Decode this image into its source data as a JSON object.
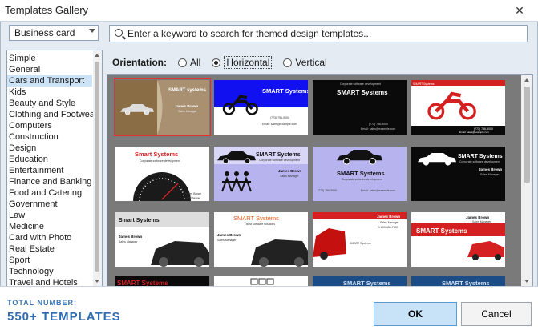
{
  "window": {
    "title": "Templates Gallery",
    "close_glyph": "✕"
  },
  "category_select": {
    "value": "Business card"
  },
  "search": {
    "placeholder": "Enter a keyword to search for themed design templates...",
    "value": ""
  },
  "categories": [
    {
      "label": "Simple"
    },
    {
      "label": "General"
    },
    {
      "label": "Cars and Transport",
      "selected": true
    },
    {
      "label": "Kids"
    },
    {
      "label": "Beauty and Style"
    },
    {
      "label": "Clothing and Footwear"
    },
    {
      "label": "Computers"
    },
    {
      "label": "Construction"
    },
    {
      "label": "Design"
    },
    {
      "label": "Education"
    },
    {
      "label": "Entertainment"
    },
    {
      "label": "Finance and Banking"
    },
    {
      "label": "Food and Catering"
    },
    {
      "label": "Government"
    },
    {
      "label": "Law"
    },
    {
      "label": "Medicine"
    },
    {
      "label": "Card with Photo"
    },
    {
      "label": "Real Estate"
    },
    {
      "label": "Sport"
    },
    {
      "label": "Technology"
    },
    {
      "label": "Travel and Hotels"
    }
  ],
  "orientation": {
    "label": "Orientation:",
    "options": [
      {
        "label": "All",
        "checked": false
      },
      {
        "label": "Horizontal",
        "checked": true
      },
      {
        "label": "Vertical",
        "checked": false
      }
    ]
  },
  "templates": [
    {
      "style": "photo-rally",
      "company": "SMART systems",
      "name": "James Brown",
      "role": "Sales Manager",
      "selected": true
    },
    {
      "style": "blue-moto",
      "company": "SMART Systems",
      "phone": "(773) 756-9000",
      "email": "Email: sales@example.com"
    },
    {
      "style": "black-plain",
      "company": "SMART Systems",
      "tagline": "Corporate software development",
      "phone": "(773) 756-9000",
      "email": "Email: sales@example.com"
    },
    {
      "style": "red-moto",
      "company": "SMART Systems",
      "phone": "(773) 756-9000",
      "email": "Email: sales@example.com"
    },
    {
      "style": "white-gauge",
      "company": "Smart Systems",
      "tagline": "Corporate software development",
      "name": "James Brown",
      "role": "Sales Manager"
    },
    {
      "style": "lilac-car",
      "company": "SMART Systems",
      "tagline": "Corporate software development",
      "name": "James Brown",
      "role": "Sales Manager"
    },
    {
      "style": "lilac-car2",
      "company": "SMART Systems",
      "tagline": "Corporate software development",
      "name": "James Brown",
      "role": "Sales Manager",
      "phone": "(773) 756-9000",
      "email": "Email: sales@example.com"
    },
    {
      "style": "black-car",
      "company": "SMART Systems",
      "tagline": "Corporate software development",
      "name": "James Brown",
      "role": "Sales Manager"
    },
    {
      "style": "white-sport1",
      "company": "Smart Systems",
      "name": "James Brown",
      "role": "Sales Manager"
    },
    {
      "style": "white-sport2",
      "company": "SMART Systems",
      "tagline": "Best software solutions",
      "name": "James Brown",
      "role": "Sales Manager"
    },
    {
      "style": "red-top-car",
      "name": "James Brown",
      "role": "Sales Manager",
      "phone": "+1 800 456-7890",
      "company": "SMART Systems"
    },
    {
      "style": "red-bar-car",
      "name": "James Brown",
      "role": "Sales Manager",
      "company": "SMART Systems"
    },
    {
      "style": "dark-red",
      "company": "SMART Systems"
    },
    {
      "style": "white-icons",
      "company": ""
    },
    {
      "style": "blue-dark",
      "company": "SMART Systems"
    },
    {
      "style": "blue-dark2",
      "company": "SMART Systems"
    }
  ],
  "footer": {
    "total_label": "Total number:",
    "total_value": "550+ templates",
    "ok": "OK",
    "cancel": "Cancel"
  },
  "colors": {
    "accent": "#2d6cb0",
    "selection": "#cde3f7",
    "ok_bg": "#c8e2f8",
    "red": "#d42020",
    "blue_card": "#1010f0",
    "lilac": "#b7b3ef"
  }
}
